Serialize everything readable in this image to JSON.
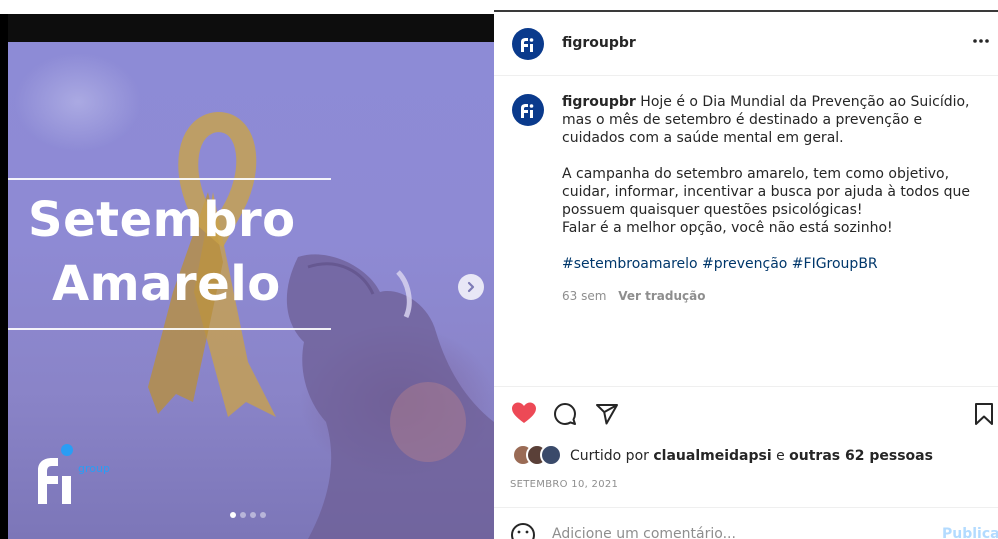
{
  "post": {
    "username": "figroupbr",
    "media": {
      "title_line1": "Setembro",
      "title_line2": "Amarelo",
      "logo_word": "group",
      "carousel_count": 4,
      "carousel_active_index": 0
    },
    "caption": {
      "username": "figroupbr",
      "paragraph1": "Hoje é o Dia Mundial da Prevenção ao Suicídio, mas o mês de setembro é destinado a prevenção e cuidados com a saúde mental em geral.",
      "paragraph2_line1": "A campanha do setembro amarelo, tem como objetivo, cuidar, informar, incentivar a busca por ajuda à todos que possuem quaisquer questões psicológicas!",
      "paragraph2_line2": "Falar é a melhor opção, você não está sozinho!",
      "hashtags": "#setembroamarelo #prevenção #FIGroupBR"
    },
    "meta": {
      "age": "63 sem",
      "translate_label": "Ver tradução"
    },
    "likes": {
      "prefix": "Curtido por",
      "user": "claualmeidapsi",
      "conjunction": "e",
      "others": "outras 62 pessoas"
    },
    "date": "SETEMBRO 10, 2021",
    "comment": {
      "placeholder": "Adicione um comentário...",
      "publish_label": "Publicar"
    },
    "icons": {
      "like": "heart-icon",
      "comment": "comment-icon",
      "share": "share-icon",
      "save": "bookmark-icon",
      "more": "more-icon",
      "next": "chevron-right-icon",
      "emoji": "emoji-icon"
    },
    "colors": {
      "like_red": "#ed4956",
      "avatar_blue": "#0a3a8c",
      "hashtag_blue": "#00376b",
      "media_purple": "#8d8bd6",
      "ribbon_yellow": "#c9a24a",
      "logo_blue": "#2a9df4"
    }
  }
}
